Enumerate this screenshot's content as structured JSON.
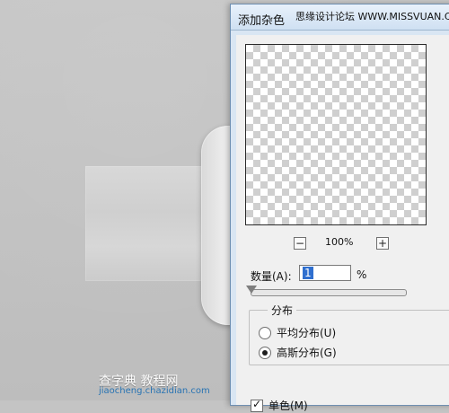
{
  "dialog": {
    "title": "添加杂色",
    "watermark": "思缘设计论坛 WWW.MISSVUAN.COM",
    "zoom": {
      "value": "100%"
    },
    "amount": {
      "label": "数量(A):",
      "value": "1",
      "unit": "%"
    },
    "distribution": {
      "title": "分布",
      "options": [
        {
          "label": "平均分布(U)",
          "selected": false
        },
        {
          "label": "高斯分布(G)",
          "selected": true
        }
      ]
    },
    "monochrome": {
      "label": "单色(M)",
      "checked": true
    }
  },
  "footer_watermark": {
    "line1": "查字典 教程网",
    "line2": "jiaocheng.chazidian.com"
  }
}
